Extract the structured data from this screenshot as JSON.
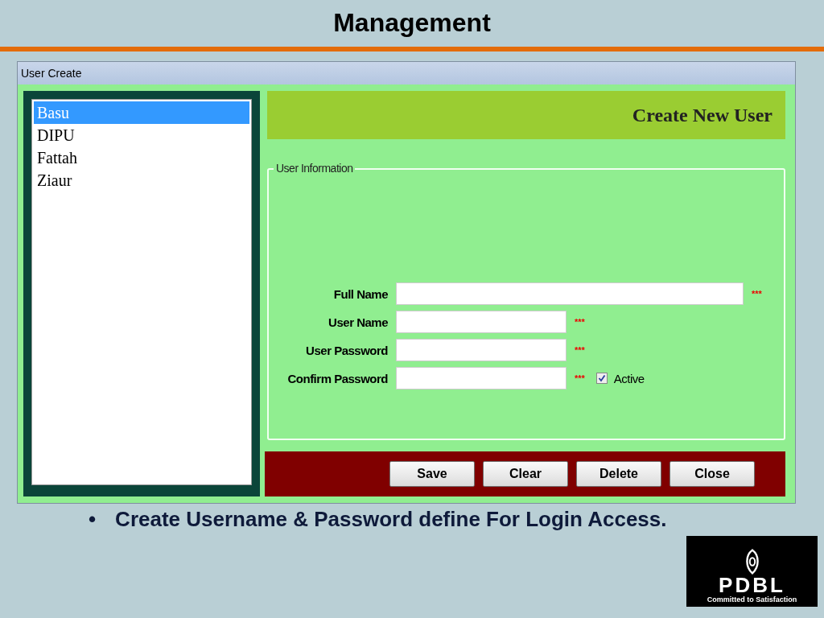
{
  "slide_title": "Management",
  "window": {
    "title": "User Create"
  },
  "user_list": [
    {
      "label": "Basu",
      "selected": true
    },
    {
      "label": "DIPU",
      "selected": false
    },
    {
      "label": "Fattah",
      "selected": false
    },
    {
      "label": "Ziaur",
      "selected": false
    }
  ],
  "header": "Create New User",
  "group": {
    "title": "User Information",
    "fields": [
      {
        "label": "Full Name",
        "required_mark": "***",
        "wide": true
      },
      {
        "label": "User Name",
        "required_mark": "***",
        "wide": false
      },
      {
        "label": "User Password",
        "required_mark": "***",
        "wide": false
      },
      {
        "label": "Confirm Password",
        "required_mark": "***",
        "wide": false
      }
    ],
    "active": {
      "label": "Active",
      "checked": true
    }
  },
  "buttons": [
    "Save",
    "Clear",
    "Delete",
    "Close"
  ],
  "bullet": {
    "marker": "•",
    "text": "Create Username & Password define For Login Access."
  },
  "logo": {
    "name": "PDBL",
    "tagline": "Committed to Satisfaction"
  }
}
